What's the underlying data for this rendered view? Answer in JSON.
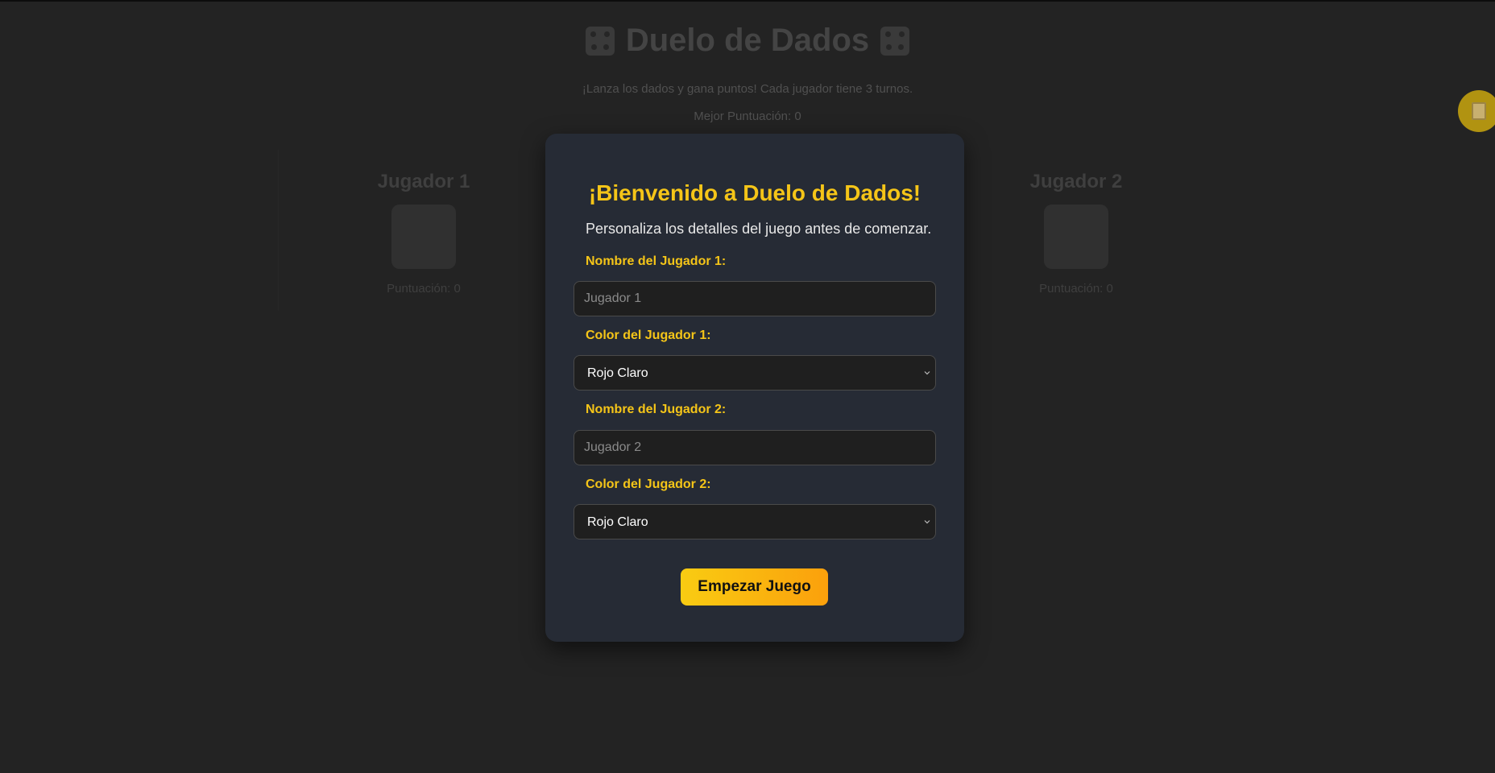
{
  "game": {
    "title": "Duelo de Dados",
    "title_icon": "dice-icon",
    "subtitle": "¡Lanza los dados y gana puntos! Cada jugador tiene 3 turnos.",
    "best_score": "Mejor Puntuación: 0"
  },
  "players": [
    {
      "name": "Jugador 1",
      "score": "Puntuación: 0"
    },
    {
      "name": "Jugador 2",
      "score": "Puntuación: 0"
    }
  ],
  "help_button": {
    "icon": "scroll-icon",
    "color": "#b19311"
  },
  "modal": {
    "title": "¡Bienvenido a Duelo de Dados!",
    "description": "Personaliza los detalles del juego antes de comenzar.",
    "fields": {
      "player1_name_label": "Nombre del Jugador 1:",
      "player1_name_placeholder": "Jugador 1",
      "player1_name_value": "",
      "player1_color_label": "Color del Jugador 1:",
      "player1_color_value": "Rojo Claro",
      "player2_name_label": "Nombre del Jugador 2:",
      "player2_name_placeholder": "Jugador 2",
      "player2_name_value": "",
      "player2_color_label": "Color del Jugador 2:",
      "player2_color_value": "Rojo Claro"
    },
    "start_button": "Empezar Juego",
    "accent_color": "#f5c518",
    "background_color": "#262b35"
  }
}
